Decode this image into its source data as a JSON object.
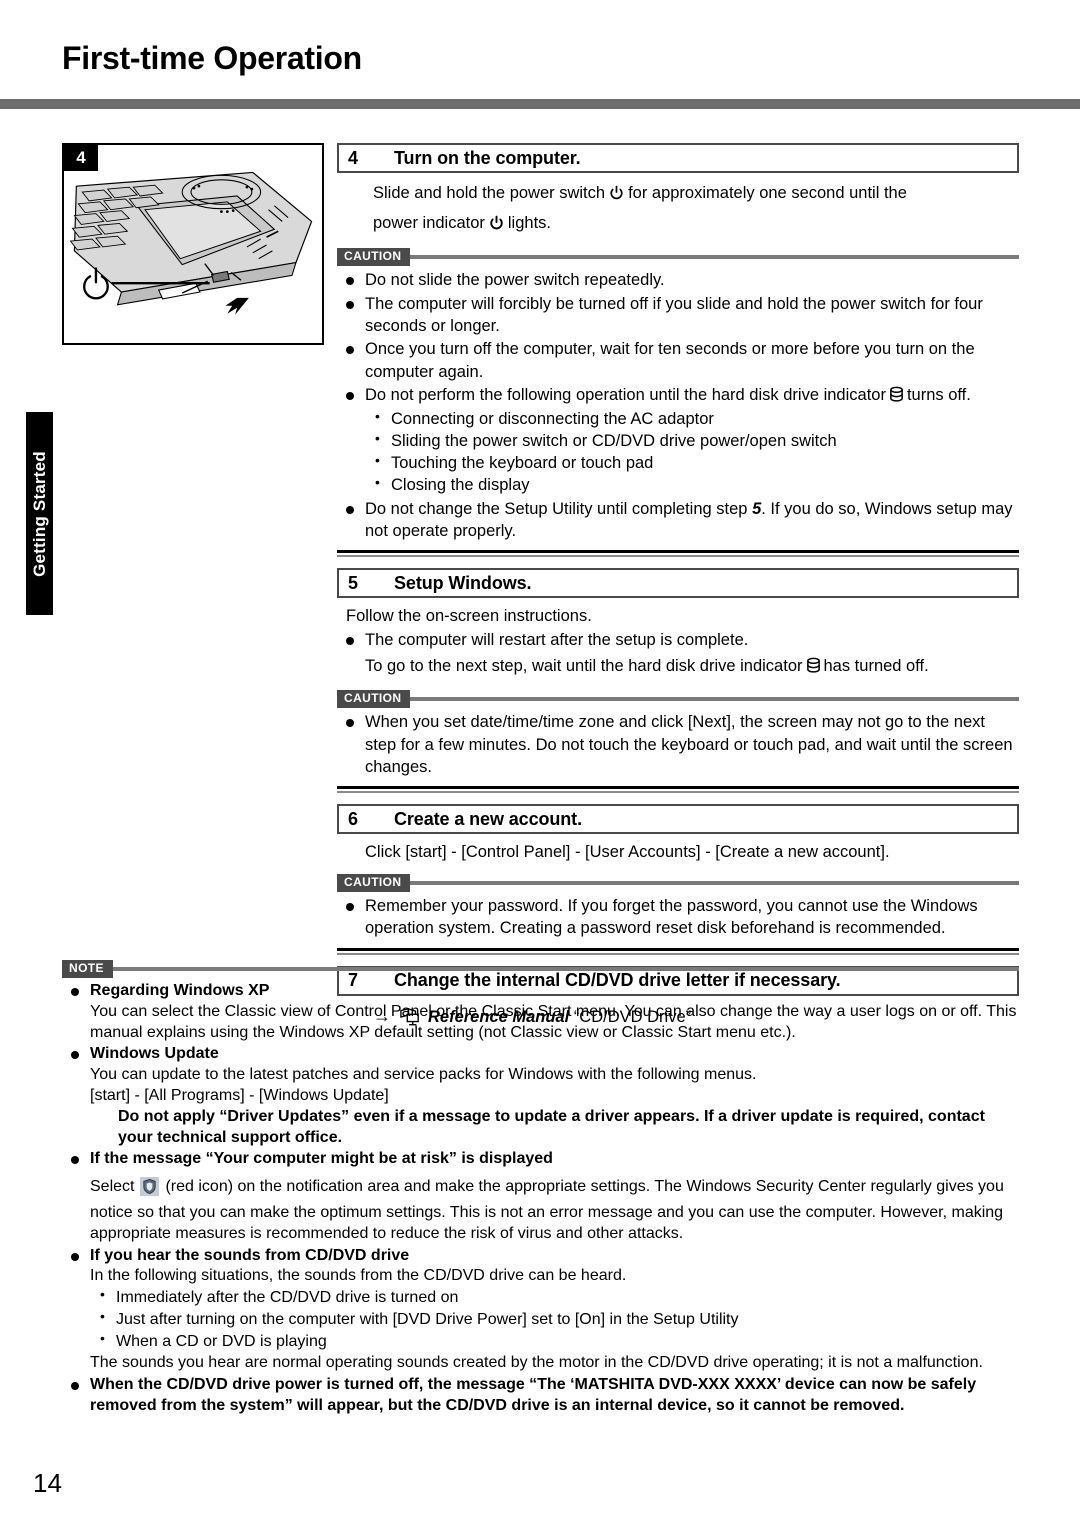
{
  "page": {
    "title": "First-time Operation",
    "number": "14",
    "side_tab": "Getting Started"
  },
  "figure": {
    "badge": "4",
    "alt_name": "laptop-power-switch-illustration"
  },
  "steps": [
    {
      "number": "4",
      "title": "Turn on the computer.",
      "intro_a": "Slide and hold the power switch",
      "intro_b": "for approximately one second until the",
      "intro_c": "power indicator",
      "intro_d": "lights.",
      "caution_label": "CAUTION",
      "bullets": [
        "Do not slide the power switch repeatedly.",
        "The computer will forcibly be turned off if you slide and hold the power switch for four seconds or longer.",
        "Once you turn off the computer, wait for ten seconds or more before you turn on the computer again."
      ],
      "bullet_hdd_a": "Do not perform the following operation until the hard disk drive indicator",
      "bullet_hdd_b": "turns off.",
      "sub_bullets": [
        "Connecting or disconnecting the AC adaptor",
        "Sliding the power switch or CD/DVD drive power/open switch",
        "Touching the keyboard or touch pad",
        "Closing the display"
      ],
      "bullet_setup_a": "Do not change the Setup Utility until completing step",
      "bullet_setup_num": "5",
      "bullet_setup_b": ". If you do so, Windows setup may not operate properly."
    },
    {
      "number": "5",
      "title": "Setup Windows.",
      "intro": "Follow the on-screen instructions.",
      "bullet": "The computer will restart after the setup is complete.",
      "note_a": "To go to the next step, wait until the hard disk drive indicator",
      "note_b": "has turned off.",
      "caution_label": "CAUTION",
      "caution_bullet": "When you set date/time/time zone and click [Next], the screen may not go to the next step for a few minutes. Do not touch the keyboard or touch pad, and wait until the screen changes."
    },
    {
      "number": "6",
      "title": "Create a new account.",
      "intro": "Click [start] - [Control Panel] - [User Accounts] - [Create a new account].",
      "caution_label": "CAUTION",
      "caution_bullet": "Remember your password. If you forget the password, you cannot use the Windows operation system. Creating a password reset disk beforehand is recommended."
    },
    {
      "number": "7",
      "title": "Change the internal CD/DVD drive letter if necessary.",
      "ref_arrow": "→",
      "ref_manual": "Reference Manual",
      "ref_target": "“CD/DVD Drive”"
    }
  ],
  "note": {
    "label": "NOTE",
    "items": [
      {
        "heading": "Regarding Windows XP",
        "lines": [
          "You can select the Classic view of Control Panel or the Classic Start menu. You can also change the way a user logs on or off. This manual explains using the Windows XP default setting (not Classic view or Classic Start menu etc.)."
        ]
      },
      {
        "heading": "Windows Update",
        "lines": [
          "You can update to the latest patches and service packs for Windows with the following menus.",
          "[start] - [All Programs] - [Windows Update]"
        ],
        "bold_line": "Do not apply “Driver Updates” even if a message to update a driver appears. If a driver update is required, contact your technical support office."
      },
      {
        "heading": "If the message “Your computer might be at risk” is displayed",
        "select_prefix": "Select",
        "select_suffix": "(red icon) on the notification area and make the appropriate settings. The Windows Security Center regularly gives you notice so that you can make the optimum settings. This is not an error message and you can use the computer. However, making appropriate measures is recommended to reduce the risk of virus and other attacks."
      },
      {
        "heading": "If you hear the sounds from CD/DVD drive",
        "lines": [
          "In the following situations, the sounds from the CD/DVD drive can be heard."
        ],
        "sub_bullets": [
          "Immediately after the CD/DVD drive is turned on",
          "Just after turning on the computer with [DVD Drive Power] set to [On] in the Setup Utility",
          "When a CD or DVD is playing"
        ],
        "closing": "The sounds you hear are normal operating sounds created by the motor in the CD/DVD drive operating; it is not a malfunction."
      },
      {
        "bold_bullet": "When the CD/DVD drive power is turned off, the message “The ‘MATSHITA DVD-XXX XXXX’ device can now be safely removed from the system” will appear, but the CD/DVD drive is an internal device, so it cannot be removed."
      }
    ]
  },
  "colors": {
    "header_rule": "#6d6d6d",
    "tag_bg": "#4a4a4a",
    "tag_rule": "#7a7a7a",
    "side_tab_bg": "#000000"
  }
}
